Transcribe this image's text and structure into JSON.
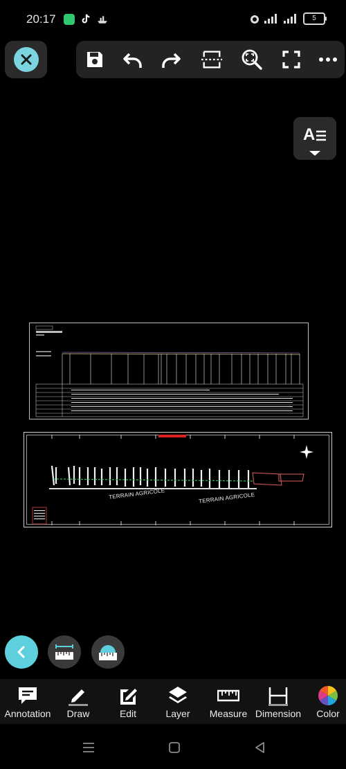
{
  "status": {
    "time": "20:17",
    "battery_level": "5"
  },
  "toolbar": {
    "icons": [
      "save-icon",
      "undo-icon",
      "redo-icon",
      "scan-icon",
      "zoom-fit-icon",
      "fullscreen-icon",
      "more-icon"
    ]
  },
  "text_style": {
    "label": "A"
  },
  "drawing": {
    "terrain_label_1": "TERRAIN AGRICOLE",
    "terrain_label_2": "TERRAIN AGRICOLE"
  },
  "bottom_tools": [
    {
      "label": "Annotation",
      "icon": "annotation-icon"
    },
    {
      "label": "Draw",
      "icon": "pen-icon"
    },
    {
      "label": "Edit",
      "icon": "edit-icon"
    },
    {
      "label": "Layer",
      "icon": "layers-icon"
    },
    {
      "label": "Measure",
      "icon": "ruler-icon"
    },
    {
      "label": "Dimension",
      "icon": "dimension-icon"
    },
    {
      "label": "Color",
      "icon": "color-wheel-icon"
    }
  ],
  "colors": {
    "accent": "#5ecfdd",
    "background": "#000000",
    "toolbar": "#232323"
  }
}
